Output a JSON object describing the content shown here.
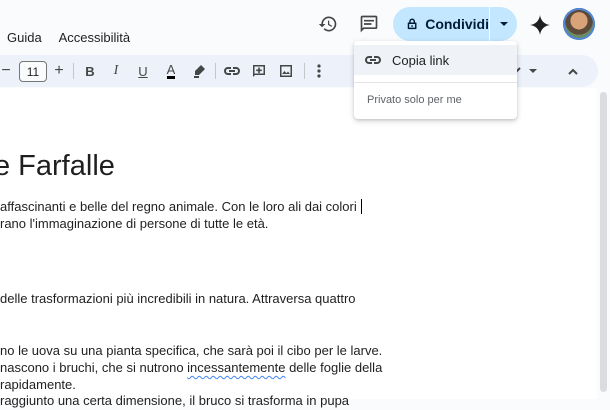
{
  "menu": {
    "items": [
      "Guida",
      "Accessibilità"
    ]
  },
  "header": {
    "share_label": "Condividi",
    "colors": {
      "share_bg": "#c2e7ff",
      "toolbar_bg": "#edf2fa"
    }
  },
  "toolbar": {
    "font_size": "11",
    "minus": "−",
    "plus": "+",
    "bold": "B",
    "italic": "I",
    "underline": "U",
    "text_color": "A"
  },
  "share_menu": {
    "copy_link": "Copia link",
    "access_note": "Privato solo per me"
  },
  "document": {
    "title": "e Farfalle",
    "lines": [
      "affascinanti e belle del regno animale. Con le loro ali dai colori",
      "rano l'immaginazione di persone di tutte le età.",
      "delle trasformazioni più incredibili in natura. Attraversa quattro",
      "no le uova su una pianta specifica, che sarà poi il cibo per le larve.",
      "rapidamente.",
      "raggiunto una certa dimensione, il bruco si trasforma in pupa"
    ],
    "line_split": {
      "before": "nascono i bruchi, che si nutrono ",
      "squiggle": "incessantemente",
      "after": " delle foglie della"
    }
  },
  "icons": [
    "history-icon",
    "comment-icon",
    "lock-icon",
    "chevron-down-icon",
    "gemini-icon",
    "link-icon"
  ]
}
